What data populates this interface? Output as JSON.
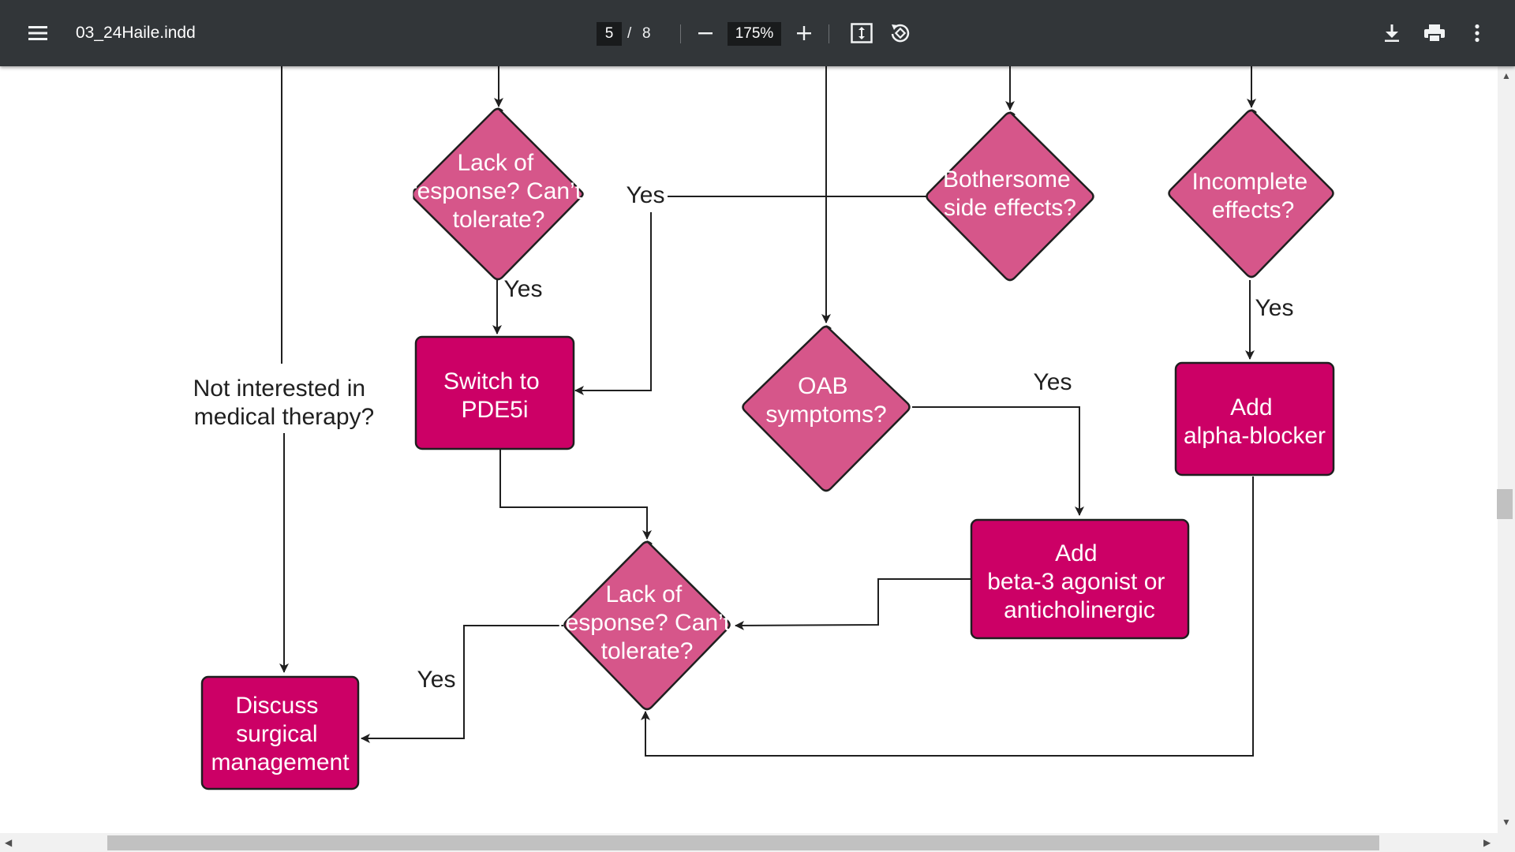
{
  "toolbar": {
    "title": "03_24Haile.indd",
    "current_page": "5",
    "page_separator": "/",
    "total_pages": "8",
    "zoom": "175%"
  },
  "icons": [
    "menu-icon",
    "zoom-out-icon",
    "zoom-in-icon",
    "fit-page-icon",
    "rotate-icon",
    "download-icon",
    "print-icon",
    "more-options-icon"
  ],
  "colors": {
    "toolbar_bg": "#323639",
    "box_fill": "#cc0066",
    "diamond_fill": "#d6568a",
    "outline": "#1f1f1f"
  },
  "flowchart": {
    "diamond_lack_response_top": [
      "Lack of",
      "response? Can’t",
      "tolerate?"
    ],
    "diamond_bothersome": [
      "Bothersome",
      "side effects?"
    ],
    "diamond_incomplete": [
      "Incomplete",
      "effects?"
    ],
    "diamond_oab": [
      "OAB",
      "symptoms?"
    ],
    "diamond_lack_response_bottom": [
      "Lack of",
      "response? Can’t",
      "tolerate?"
    ],
    "box_switch_pde5i": [
      "Switch to",
      "PDE5i"
    ],
    "box_add_alpha_blocker": [
      "Add",
      "alpha-blocker"
    ],
    "box_add_beta3": [
      "Add",
      "beta-3 agonist or",
      "anticholinergic"
    ],
    "box_discuss_surgical": [
      "Discuss",
      "surgical",
      "management"
    ],
    "label_not_interested": [
      "Not interested in",
      "medical therapy?"
    ],
    "yes_label": "Yes"
  }
}
